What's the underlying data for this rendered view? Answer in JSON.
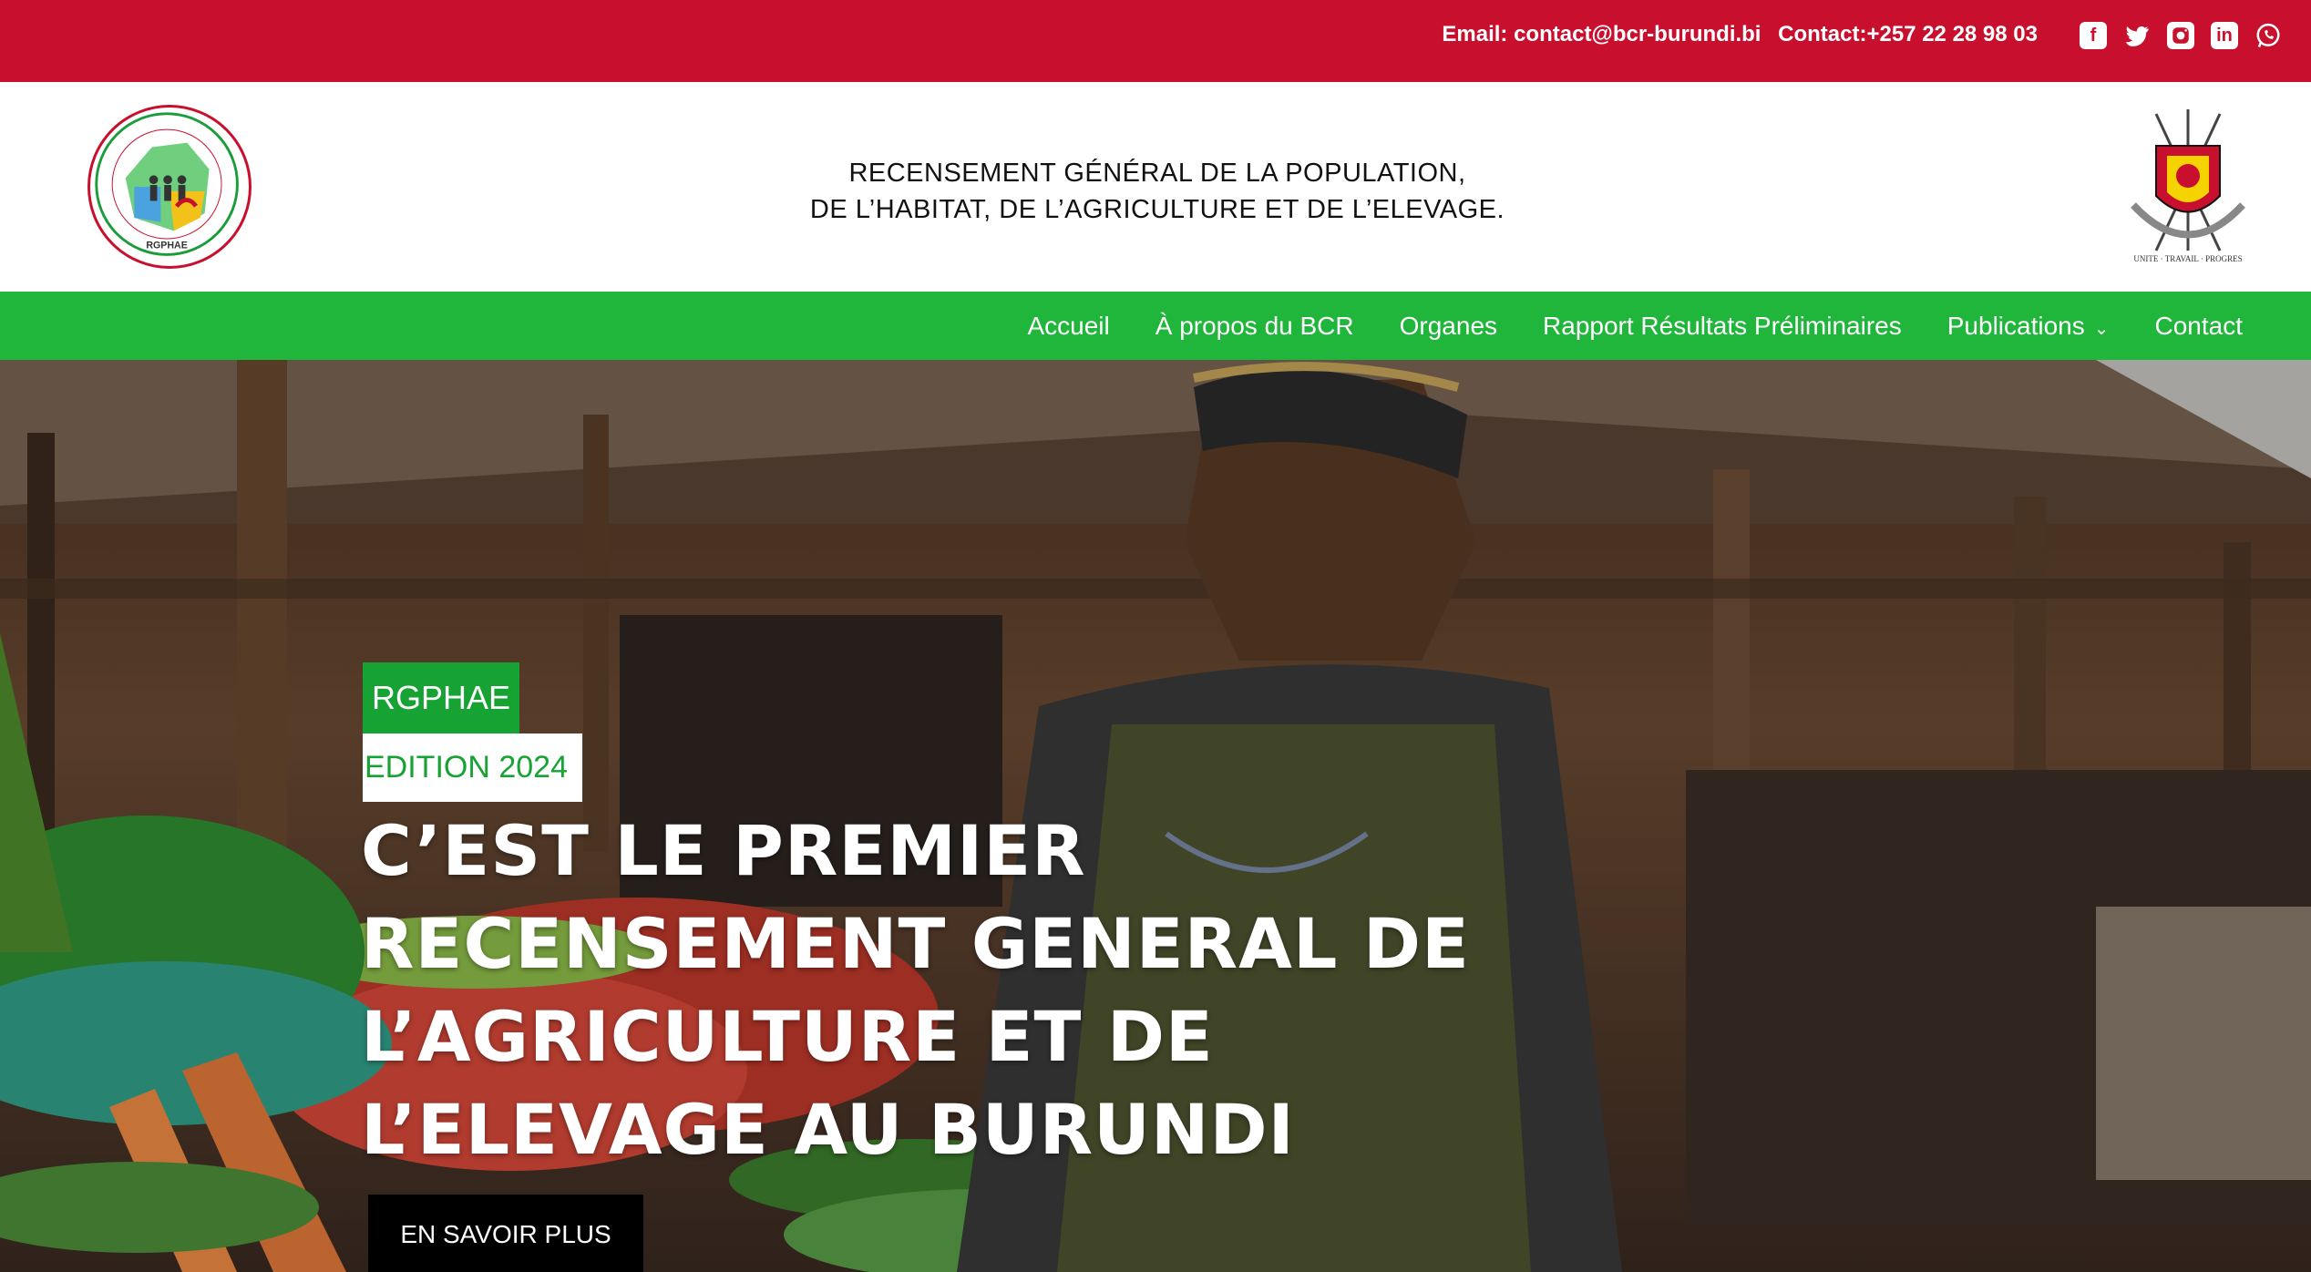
{
  "topbar": {
    "email": "Email: contact@bcr-burundi.bi",
    "phone": "Contact:+257 22 28 98 03",
    "socials": [
      "facebook-icon",
      "twitter-icon",
      "instagram-icon",
      "linkedin-icon",
      "whatsapp-icon"
    ]
  },
  "header": {
    "title_line1": "RECENSEMENT GÉNÉRAL DE LA POPULATION,",
    "title_line2": "DE L’HABITAT, DE L’AGRICULTURE ET DE L’ELEVAGE.",
    "logo_text": "RGPHAE",
    "right_logo_text": "UNITE · TRAVAIL · PROGRES"
  },
  "nav": {
    "items": [
      "Accueil",
      "À propos du BCR",
      "Organes",
      "Rapport Résultats Préliminaires",
      "Publications",
      "Contact"
    ]
  },
  "hero": {
    "badge": "RGPHAE",
    "edition": "EDITION 2024",
    "heading_lines": [
      "C’EST LE PREMIER",
      "RECENSEMENT GENERAL DE",
      "L’AGRICULTURE ET DE",
      "L’ELEVAGE AU BURUNDI"
    ],
    "cta": "EN SAVOIR PLUS"
  },
  "colors": {
    "topbar": "#c8102e",
    "nav": "#20b53b",
    "badge": "#17a234"
  }
}
